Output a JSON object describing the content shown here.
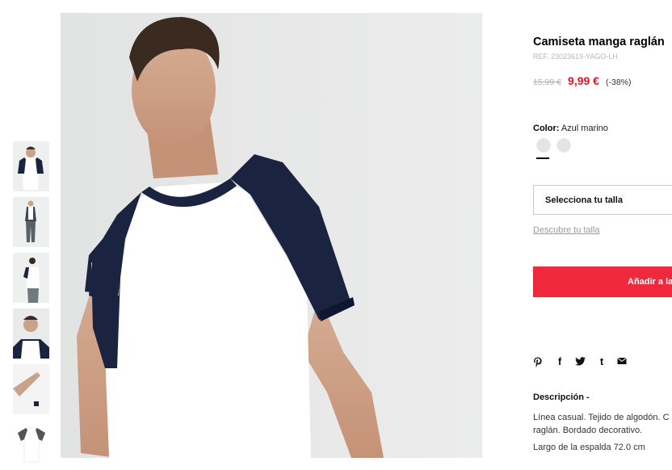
{
  "product": {
    "title": "Camiseta manga raglán",
    "ref": "REF. 23023619-YAGO-LH",
    "old_price": "15,99 €",
    "price": "9,99 €",
    "discount": "(-38%)"
  },
  "color": {
    "label": "Color:",
    "value": "Azul marino"
  },
  "size": {
    "select_label": "Selecciona tu talla",
    "guide_link": "Descubre tu talla"
  },
  "cart": {
    "add_label": "Añadir a la"
  },
  "social": [
    "pinterest-icon",
    "facebook-icon",
    "twitter-icon",
    "tumblr-icon",
    "email-icon"
  ],
  "description": {
    "title": "Descripción -",
    "line1": "Línea casual. Tejido de algodón. C",
    "line2": "raglán. Bordado decorativo.",
    "measure": "Largo de la espalda 72.0 cm"
  },
  "colors": {
    "accent": "#f0283b",
    "price": "#e1142e",
    "navy": "#1a2440"
  }
}
